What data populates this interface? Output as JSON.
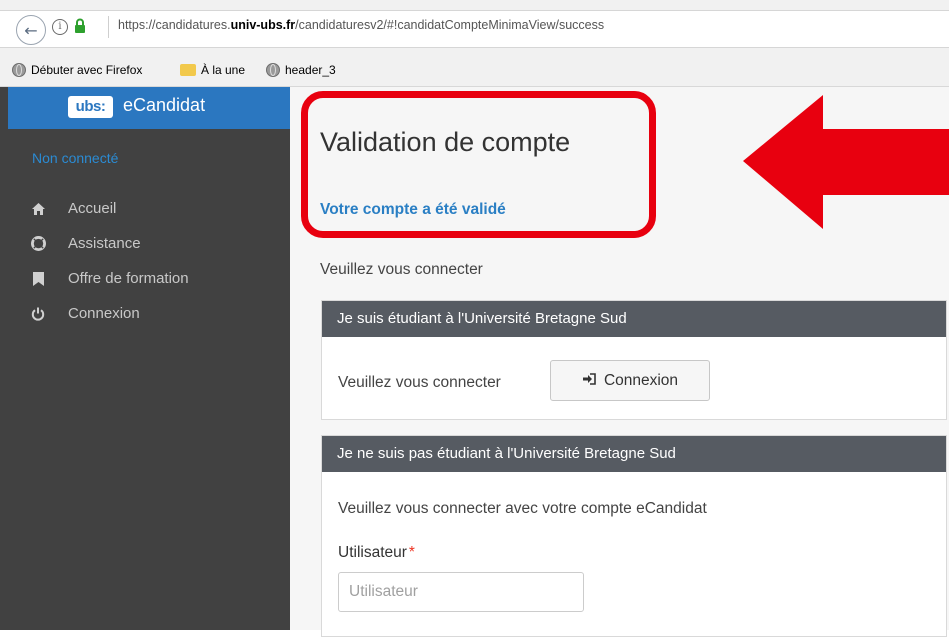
{
  "browser": {
    "url_prefix": "https://candidatures.",
    "url_domain": "univ-ubs.fr",
    "url_path": "/candidaturesv2/#!candidatCompteMinimaView/success",
    "bookmarks": [
      {
        "label": "Débuter avec Firefox",
        "icon": "globe-icon"
      },
      {
        "label": "À la une",
        "icon": "folder-icon"
      },
      {
        "label": "header_3",
        "icon": "globe-icon"
      }
    ]
  },
  "sidebar": {
    "logo_text": "ubs:",
    "app_title": "eCandidat",
    "status": "Non connecté",
    "items": [
      {
        "label": "Accueil",
        "icon": "home-icon"
      },
      {
        "label": "Assistance",
        "icon": "lifebuoy-icon"
      },
      {
        "label": "Offre de formation",
        "icon": "bookmark-icon"
      },
      {
        "label": "Connexion",
        "icon": "power-icon"
      }
    ]
  },
  "main": {
    "title": "Validation de compte",
    "validated_message": "Votre compte a été validé",
    "please_connect": "Veuillez vous connecter",
    "panel_student": {
      "header": "Je suis étudiant à l'Université Bretagne Sud",
      "text": "Veuillez vous connecter",
      "button_label": "Connexion"
    },
    "panel_other": {
      "header": "Je ne suis pas étudiant à l'Université Bretagne Sud",
      "text": "Veuillez vous connecter avec votre compte eCandidat",
      "user_label": "Utilisateur",
      "required_mark": "*",
      "user_placeholder": "Utilisateur"
    }
  },
  "colors": {
    "annotation": "#e8000f",
    "accent": "#2b77c0",
    "sidebar_bg": "#414141",
    "panel_header": "#565b62"
  }
}
